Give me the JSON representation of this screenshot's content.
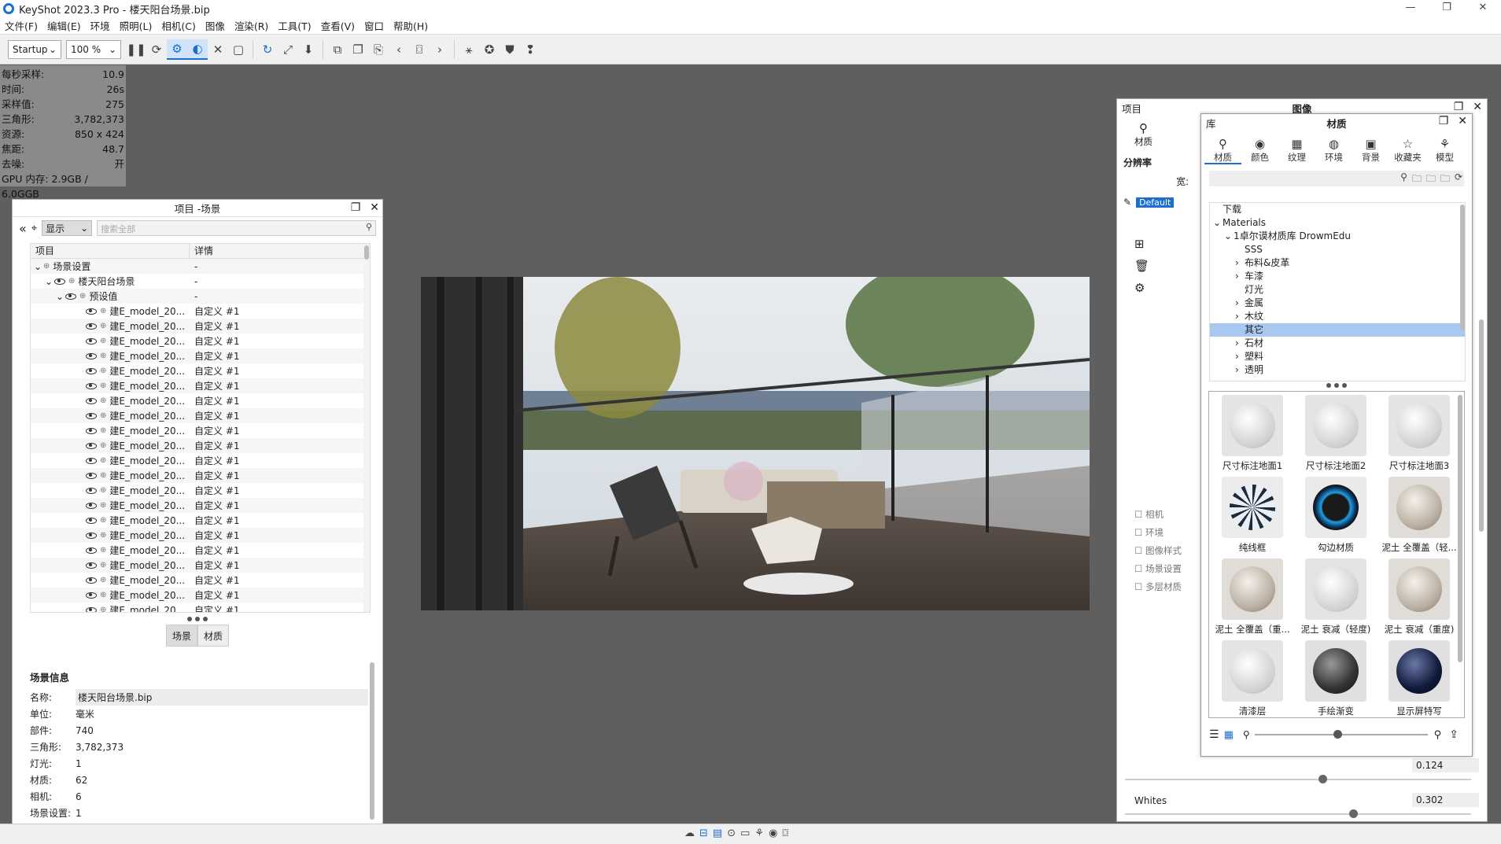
{
  "window": {
    "title": "KeyShot 2023.3 Pro  - 楼天阳台场景.bip",
    "min": "—",
    "max": "❐",
    "close": "✕"
  },
  "menu": [
    "文件(F)",
    "编辑(E)",
    "环境",
    "照明(L)",
    "相机(C)",
    "图像",
    "渲染(R)",
    "工具(T)",
    "查看(V)",
    "窗口",
    "帮助(H)"
  ],
  "toolbar": {
    "preset": "Startup",
    "zoom": "100 %"
  },
  "stats": [
    {
      "k": "每秒采样:",
      "v": "10.9"
    },
    {
      "k": "时间:",
      "v": "26s"
    },
    {
      "k": "采样值:",
      "v": "275"
    },
    {
      "k": "三角形:",
      "v": "3,782,373"
    },
    {
      "k": "资源:",
      "v": "850 x 424"
    },
    {
      "k": "焦距:",
      "v": "48.7"
    },
    {
      "k": "去噪:",
      "v": "开"
    },
    {
      "k": "GPU 内存: 2.9GB / 6.0GGB",
      "v": ""
    }
  ],
  "project": {
    "title": "项目 -场景",
    "filter": "显示",
    "search_placeholder": "搜索全部",
    "col_item": "项目",
    "col_detail": "详情",
    "rows": [
      {
        "indent": 0,
        "label": "场景设置",
        "detail": "-",
        "eye": false,
        "arrow": "⌄"
      },
      {
        "indent": 1,
        "label": "楼天阳台场景",
        "detail": "-",
        "eye": true,
        "arrow": "⌄"
      },
      {
        "indent": 2,
        "label": "预设值",
        "detail": "-",
        "eye": true,
        "arrow": "⌄"
      },
      {
        "indent": 3,
        "label": "建E_model_20...",
        "detail": "自定义 #1",
        "eye": true,
        "arrow": ""
      },
      {
        "indent": 3,
        "label": "建E_model_20...",
        "detail": "自定义 #1",
        "eye": true,
        "arrow": ""
      },
      {
        "indent": 3,
        "label": "建E_model_20...",
        "detail": "自定义 #1",
        "eye": true,
        "arrow": ""
      },
      {
        "indent": 3,
        "label": "建E_model_20...",
        "detail": "自定义 #1",
        "eye": true,
        "arrow": ""
      },
      {
        "indent": 3,
        "label": "建E_model_20...",
        "detail": "自定义 #1",
        "eye": true,
        "arrow": ""
      },
      {
        "indent": 3,
        "label": "建E_model_20...",
        "detail": "自定义 #1",
        "eye": true,
        "arrow": ""
      },
      {
        "indent": 3,
        "label": "建E_model_20...",
        "detail": "自定义 #1",
        "eye": true,
        "arrow": ""
      },
      {
        "indent": 3,
        "label": "建E_model_20...",
        "detail": "自定义 #1",
        "eye": true,
        "arrow": ""
      },
      {
        "indent": 3,
        "label": "建E_model_20...",
        "detail": "自定义 #1",
        "eye": true,
        "arrow": ""
      },
      {
        "indent": 3,
        "label": "建E_model_20...",
        "detail": "自定义 #1",
        "eye": true,
        "arrow": ""
      },
      {
        "indent": 3,
        "label": "建E_model_20...",
        "detail": "自定义 #1",
        "eye": true,
        "arrow": ""
      },
      {
        "indent": 3,
        "label": "建E_model_20...",
        "detail": "自定义 #1",
        "eye": true,
        "arrow": ""
      },
      {
        "indent": 3,
        "label": "建E_model_20...",
        "detail": "自定义 #1",
        "eye": true,
        "arrow": ""
      },
      {
        "indent": 3,
        "label": "建E_model_20...",
        "detail": "自定义 #1",
        "eye": true,
        "arrow": ""
      },
      {
        "indent": 3,
        "label": "建E_model_20...",
        "detail": "自定义 #1",
        "eye": true,
        "arrow": ""
      },
      {
        "indent": 3,
        "label": "建E_model_20...",
        "detail": "自定义 #1",
        "eye": true,
        "arrow": ""
      },
      {
        "indent": 3,
        "label": "建E_model_20...",
        "detail": "自定义 #1",
        "eye": true,
        "arrow": ""
      },
      {
        "indent": 3,
        "label": "建E_model_20...",
        "detail": "自定义 #1",
        "eye": true,
        "arrow": ""
      },
      {
        "indent": 3,
        "label": "建E_model_20...",
        "detail": "自定义 #1",
        "eye": true,
        "arrow": ""
      },
      {
        "indent": 3,
        "label": "建E_model_20...",
        "detail": "自定义 #1",
        "eye": true,
        "arrow": ""
      },
      {
        "indent": 3,
        "label": "建E_model_20...",
        "detail": "自定义 #1",
        "eye": true,
        "arrow": ""
      },
      {
        "indent": 3,
        "label": "建E_model_20...",
        "detail": "自定义 #1",
        "eye": true,
        "arrow": ""
      }
    ],
    "tab_scene": "场景",
    "tab_material": "材质",
    "info_title": "场景信息",
    "info": [
      {
        "k": "名称:",
        "v": "楼天阳台场景.bip",
        "box": true
      },
      {
        "k": "单位:",
        "v": "毫米",
        "box": false
      },
      {
        "k": "部件:",
        "v": "740",
        "box": false
      },
      {
        "k": "三角形:",
        "v": "3,782,373",
        "box": false
      },
      {
        "k": "灯光:",
        "v": "1",
        "box": false
      },
      {
        "k": "材质:",
        "v": "62",
        "box": false
      },
      {
        "k": "相机:",
        "v": "6",
        "box": false
      },
      {
        "k": "场景设置:",
        "v": "1",
        "box": false
      }
    ]
  },
  "image_panel": {
    "left_label": "项目",
    "title": "图像",
    "tab_material": "材质",
    "resolution": "分辨率",
    "width_label": "宽:",
    "preset": "Default",
    "checks": [
      "相机",
      "环境",
      "图像样式",
      "场景设置",
      "多层材质"
    ],
    "value1": "0.124",
    "whites_label": "Whites",
    "whites_value": "0.302"
  },
  "library": {
    "left_label": "库",
    "title": "材质",
    "tabs": [
      {
        "icon": "⚲",
        "label": "材质",
        "on": true
      },
      {
        "icon": "◉",
        "label": "颜色",
        "on": false
      },
      {
        "icon": "▦",
        "label": "纹理",
        "on": false
      },
      {
        "icon": "◍",
        "label": "环境",
        "on": false
      },
      {
        "icon": "▣",
        "label": "背景",
        "on": false
      },
      {
        "icon": "☆",
        "label": "收藏夹",
        "on": false
      },
      {
        "icon": "⚘",
        "label": "模型",
        "on": false
      }
    ],
    "tree": [
      {
        "indent": 0,
        "arrow": "",
        "label": "下载",
        "sel": false
      },
      {
        "indent": 0,
        "arrow": "⌄",
        "label": "Materials",
        "sel": false
      },
      {
        "indent": 1,
        "arrow": "⌄",
        "label": "1卓尔谟材质库 DrowmEdu",
        "sel": false
      },
      {
        "indent": 2,
        "arrow": "",
        "label": "SSS",
        "sel": false
      },
      {
        "indent": 2,
        "arrow": "›",
        "label": "布料&皮革",
        "sel": false
      },
      {
        "indent": 2,
        "arrow": "›",
        "label": "车漆",
        "sel": false
      },
      {
        "indent": 2,
        "arrow": "",
        "label": "灯光",
        "sel": false
      },
      {
        "indent": 2,
        "arrow": "›",
        "label": "金属",
        "sel": false
      },
      {
        "indent": 2,
        "arrow": "›",
        "label": "木纹",
        "sel": false
      },
      {
        "indent": 2,
        "arrow": "",
        "label": "其它",
        "sel": true
      },
      {
        "indent": 2,
        "arrow": "›",
        "label": "石材",
        "sel": false
      },
      {
        "indent": 2,
        "arrow": "›",
        "label": "塑料",
        "sel": false
      },
      {
        "indent": 2,
        "arrow": "›",
        "label": "透明",
        "sel": false
      }
    ],
    "materials": [
      {
        "label": "尺寸标注地面1",
        "style": "white"
      },
      {
        "label": "尺寸标注地面2",
        "style": "white"
      },
      {
        "label": "尺寸标注地面3",
        "style": "white"
      },
      {
        "label": "纯线框",
        "style": "wire"
      },
      {
        "label": "勾边材质",
        "style": "blue"
      },
      {
        "label": "泥土 全覆盖（轻...",
        "style": "dirt"
      },
      {
        "label": "泥土 全覆盖（重...",
        "style": "dirt"
      },
      {
        "label": "泥土 衰减（轻度)",
        "style": "white"
      },
      {
        "label": "泥土 衰减（重度)",
        "style": "dirt"
      },
      {
        "label": "清漆层",
        "style": "white"
      },
      {
        "label": "手绘渐变",
        "style": "dark"
      },
      {
        "label": "显示屏特写",
        "style": "navy"
      }
    ]
  }
}
